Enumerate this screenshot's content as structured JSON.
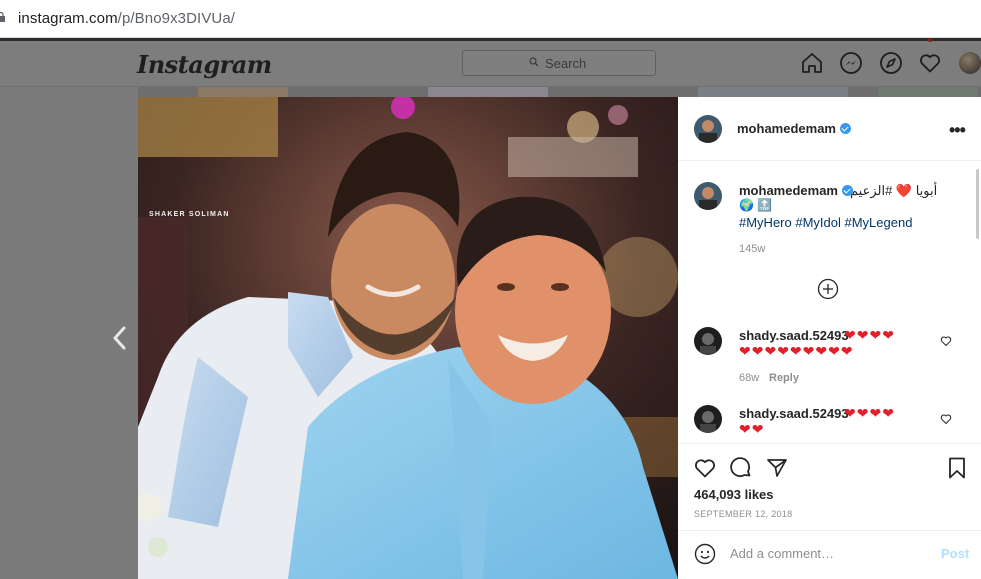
{
  "browser": {
    "url_host": "instagram.com",
    "url_path": "/p/Bno9x3DIVUa/"
  },
  "header": {
    "logo": "Instagram",
    "search_placeholder": "Search",
    "nav_icons": [
      "home-icon",
      "messenger-icon",
      "explore-compass-icon",
      "activity-heart-icon",
      "profile-avatar"
    ]
  },
  "photo": {
    "watermark": "SHAKER SOLIMAN"
  },
  "post": {
    "author": "mohamedemam",
    "verified": true,
    "caption": {
      "username": "mohamedemam",
      "arabic_text": "أبويا ❤️ #الزعيم",
      "emojis": "🌍 🔝",
      "hashtags": "#MyHero #MyIdol #MyLegend",
      "time": "145w"
    },
    "comments": [
      {
        "username": "shady.saad.52493",
        "hearts_line1": "❤❤❤❤",
        "hearts_line2": "❤❤❤❤❤❤❤❤❤",
        "time": "68w",
        "reply_label": "Reply"
      },
      {
        "username": "shady.saad.52493",
        "hearts_line1": "❤❤❤❤",
        "hearts_line2": "❤❤"
      }
    ],
    "likes": "464,093 likes",
    "date": "SEPTEMBER 12, 2018",
    "comment_placeholder": "Add a comment…",
    "post_label": "Post"
  },
  "colors": {
    "link_blue": "#00376b",
    "verified_blue": "#3897f0",
    "heart_red": "#e0202a",
    "post_button": "#b2dffc"
  }
}
